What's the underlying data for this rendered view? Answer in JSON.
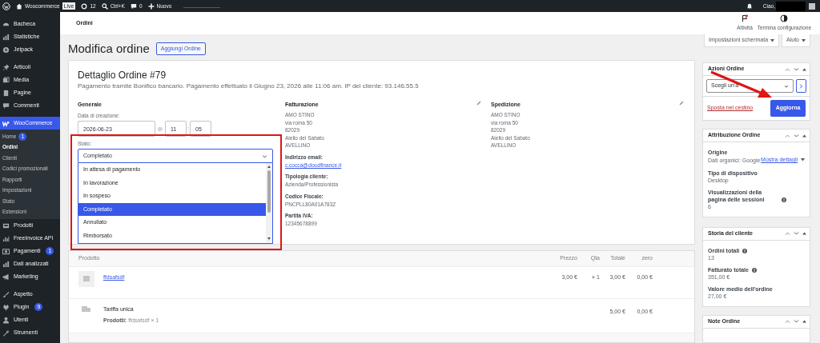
{
  "admin_bar": {
    "site": "Woocommerce",
    "badge": "Live",
    "updates": "12",
    "search": "Ctrl+K",
    "comments": "0",
    "new": "Nuovo",
    "greeting": "Ciao,"
  },
  "sidebar": {
    "groups": [
      [
        {
          "label": "Bacheca",
          "selected": false
        },
        {
          "label": "Statistiche",
          "selected": false
        },
        {
          "label": "Jetpack",
          "selected": false
        }
      ],
      [
        {
          "label": "Articoli",
          "selected": false
        },
        {
          "label": "Media",
          "selected": false
        },
        {
          "label": "Pagine",
          "selected": false
        },
        {
          "label": "Commenti",
          "selected": false
        }
      ],
      [
        {
          "label": "WooCommerce",
          "selected": true,
          "submenu": [
            {
              "label": "Home",
              "badge": "1",
              "selected": false
            },
            {
              "label": "Ordini",
              "selected": true
            },
            {
              "label": "Clienti",
              "selected": false
            },
            {
              "label": "Codici promozionali",
              "selected": false
            },
            {
              "label": "Rapporti",
              "selected": false
            },
            {
              "label": "Impostazioni",
              "selected": false
            },
            {
              "label": "Stato",
              "selected": false
            },
            {
              "label": "Estensioni",
              "selected": false
            }
          ]
        },
        {
          "label": "Prodotti",
          "selected": false
        },
        {
          "label": "FreeInvoice API",
          "selected": false
        },
        {
          "label": "Pagamenti",
          "badge": "1",
          "selected": false
        },
        {
          "label": "Dati analizzati",
          "selected": false
        },
        {
          "label": "Marketing",
          "selected": false
        }
      ],
      [
        {
          "label": "Aspetto",
          "selected": false
        },
        {
          "label": "Plugin",
          "badge": "9",
          "selected": false
        },
        {
          "label": "Utenti",
          "selected": false
        },
        {
          "label": "Strumenti",
          "selected": false
        }
      ]
    ]
  },
  "header": {
    "title": "Ordini",
    "actions": [
      {
        "label": "Attività",
        "unread": true
      },
      {
        "label": "Termina configurazione"
      }
    ]
  },
  "screen_options": [
    "Impostazioni schermata",
    "Aiuto"
  ],
  "page": {
    "title": "Modifica ordine",
    "add_button": "Aggiungi Ordine"
  },
  "order": {
    "title": "Dettaglio Ordine #79",
    "subtitle": "Pagamento tramite Bonifico bancario. Pagamento effettuato il Giugno 23, 2026 alle 11:06 am. IP del cliente: 93.146.55.5",
    "general": {
      "heading": "Generale",
      "date_label": "Data di creazione:",
      "date": "2026-06-23",
      "at": "@",
      "hour": "11",
      "sep": ":",
      "minute": "05",
      "status_label": "Stato:",
      "status": "Completato",
      "status_options": [
        {
          "label": "In attesa di pagamento",
          "selected": false
        },
        {
          "label": "In lavorazione",
          "selected": false
        },
        {
          "label": "In sospeso",
          "selected": false
        },
        {
          "label": "Completato",
          "selected": true
        },
        {
          "label": "Annullato",
          "selected": false
        },
        {
          "label": "Rimborsato",
          "selected": false
        }
      ]
    },
    "billing": {
      "heading": "Fatturazione",
      "address": [
        "AMO STINO",
        "via roma 50",
        "82029",
        "Aiello del Sabato",
        "AVELLINO"
      ],
      "fields": [
        {
          "label": "Indirizzo email:",
          "value": "c.cocca@cloudfinance.it",
          "kind": "link"
        },
        {
          "label": "Tipologia cliente:",
          "value": "Azienda/Professionista",
          "kind": "text"
        },
        {
          "label": "Codice Fiscale:",
          "value": "PNCPLL80A01A783Z",
          "kind": "text"
        },
        {
          "label": "Partita IVA:",
          "value": "12345678899",
          "kind": "text"
        }
      ]
    },
    "shipping": {
      "heading": "Spedizione",
      "address": [
        "AMO STINO",
        "via roma 50",
        "82029",
        "Aiello del Sabato",
        "AVELLINO"
      ]
    }
  },
  "items": {
    "columns": [
      "Prodotto",
      "Prezzo",
      "Qta",
      "Totale",
      "zero"
    ],
    "rows": [
      {
        "kind": "product",
        "name": "ffdsafsdf",
        "price": "3,00 €",
        "qty": "× 1",
        "total": "3,00 €",
        "zero": "0,00 €"
      },
      {
        "kind": "shipping",
        "name": "Tariffa unica",
        "meta_label": "Prodotti:",
        "meta_value": "ffdsafsdf × 1",
        "total": "5,00 €",
        "zero": "0,00 €"
      }
    ]
  },
  "panels": {
    "actions": {
      "title": "Azioni Ordine",
      "select": "Scegli un'a",
      "trash": "Sposta nel cestino",
      "submit": "Aggiorna"
    },
    "attribution": {
      "title": "Attribuzione Ordine",
      "fields": [
        {
          "label": "Origine",
          "value": "Dati organici: Google",
          "link": "Mostra dettagli"
        },
        {
          "label": "Tipo di dispositivo",
          "value": "Desktop"
        },
        {
          "label": "Visualizzazioni della pagina delle sessioni",
          "value": "6",
          "help": true
        }
      ]
    },
    "history": {
      "title": "Storia del cliente",
      "fields": [
        {
          "label": "Ordini totali",
          "value": "13",
          "help": true
        },
        {
          "label": "Fatturato totale",
          "value": "351,00 €",
          "help": true
        },
        {
          "label": "Valore medio dell'ordine",
          "value": "27,00 €",
          "help": false
        }
      ]
    },
    "notes": {
      "title": "Note Ordine"
    }
  }
}
